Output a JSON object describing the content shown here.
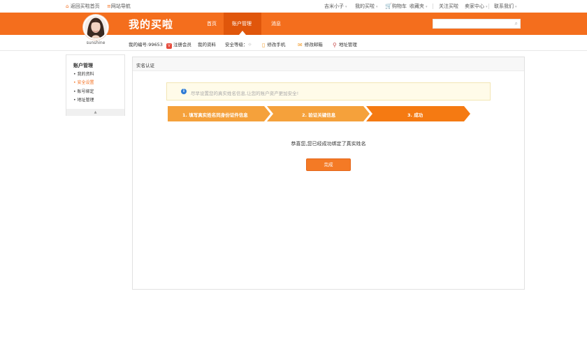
{
  "topbar": {
    "home_link": "返回买啦首页",
    "site_nav": "网站导航",
    "user": "吉米小子",
    "my_buy": "我的买啦",
    "cart": "购物车",
    "favorites": "收藏夹",
    "follow": "关注买啦",
    "seller_center": "卖家中心",
    "contact": "联系我们"
  },
  "header": {
    "logo": "我的买啦",
    "nav": [
      "首页",
      "账户管理",
      "消息"
    ],
    "search_placeholder": ""
  },
  "profile": {
    "username": "sunshine"
  },
  "infobar": {
    "account_no": "我的编号:99653",
    "register_vip": "注册会员",
    "my_profile": "我的资料",
    "security_level": "安全等级：",
    "edit_phone": "修改手机",
    "edit_email": "修改邮箱",
    "address_manage": "地址管理"
  },
  "sidebar": {
    "title": "账户管理",
    "items": [
      "我的资料",
      "安全设置",
      "账号绑定",
      "地址管理"
    ]
  },
  "main": {
    "title": "实名认证",
    "notice": "尽早设置您的真实姓名信息,让您的账户资产更加安全!",
    "steps": [
      "1. 填写真实姓名同身份证件信息",
      "2. 验证关键信息",
      "3. 成功"
    ],
    "success_message": "恭喜您,您已经成功绑定了真实姓名",
    "done_button": "完成"
  },
  "colors": {
    "brand_orange": "#f46e1d",
    "step_orange": "#f5a13b",
    "step_active": "#f57a12"
  }
}
